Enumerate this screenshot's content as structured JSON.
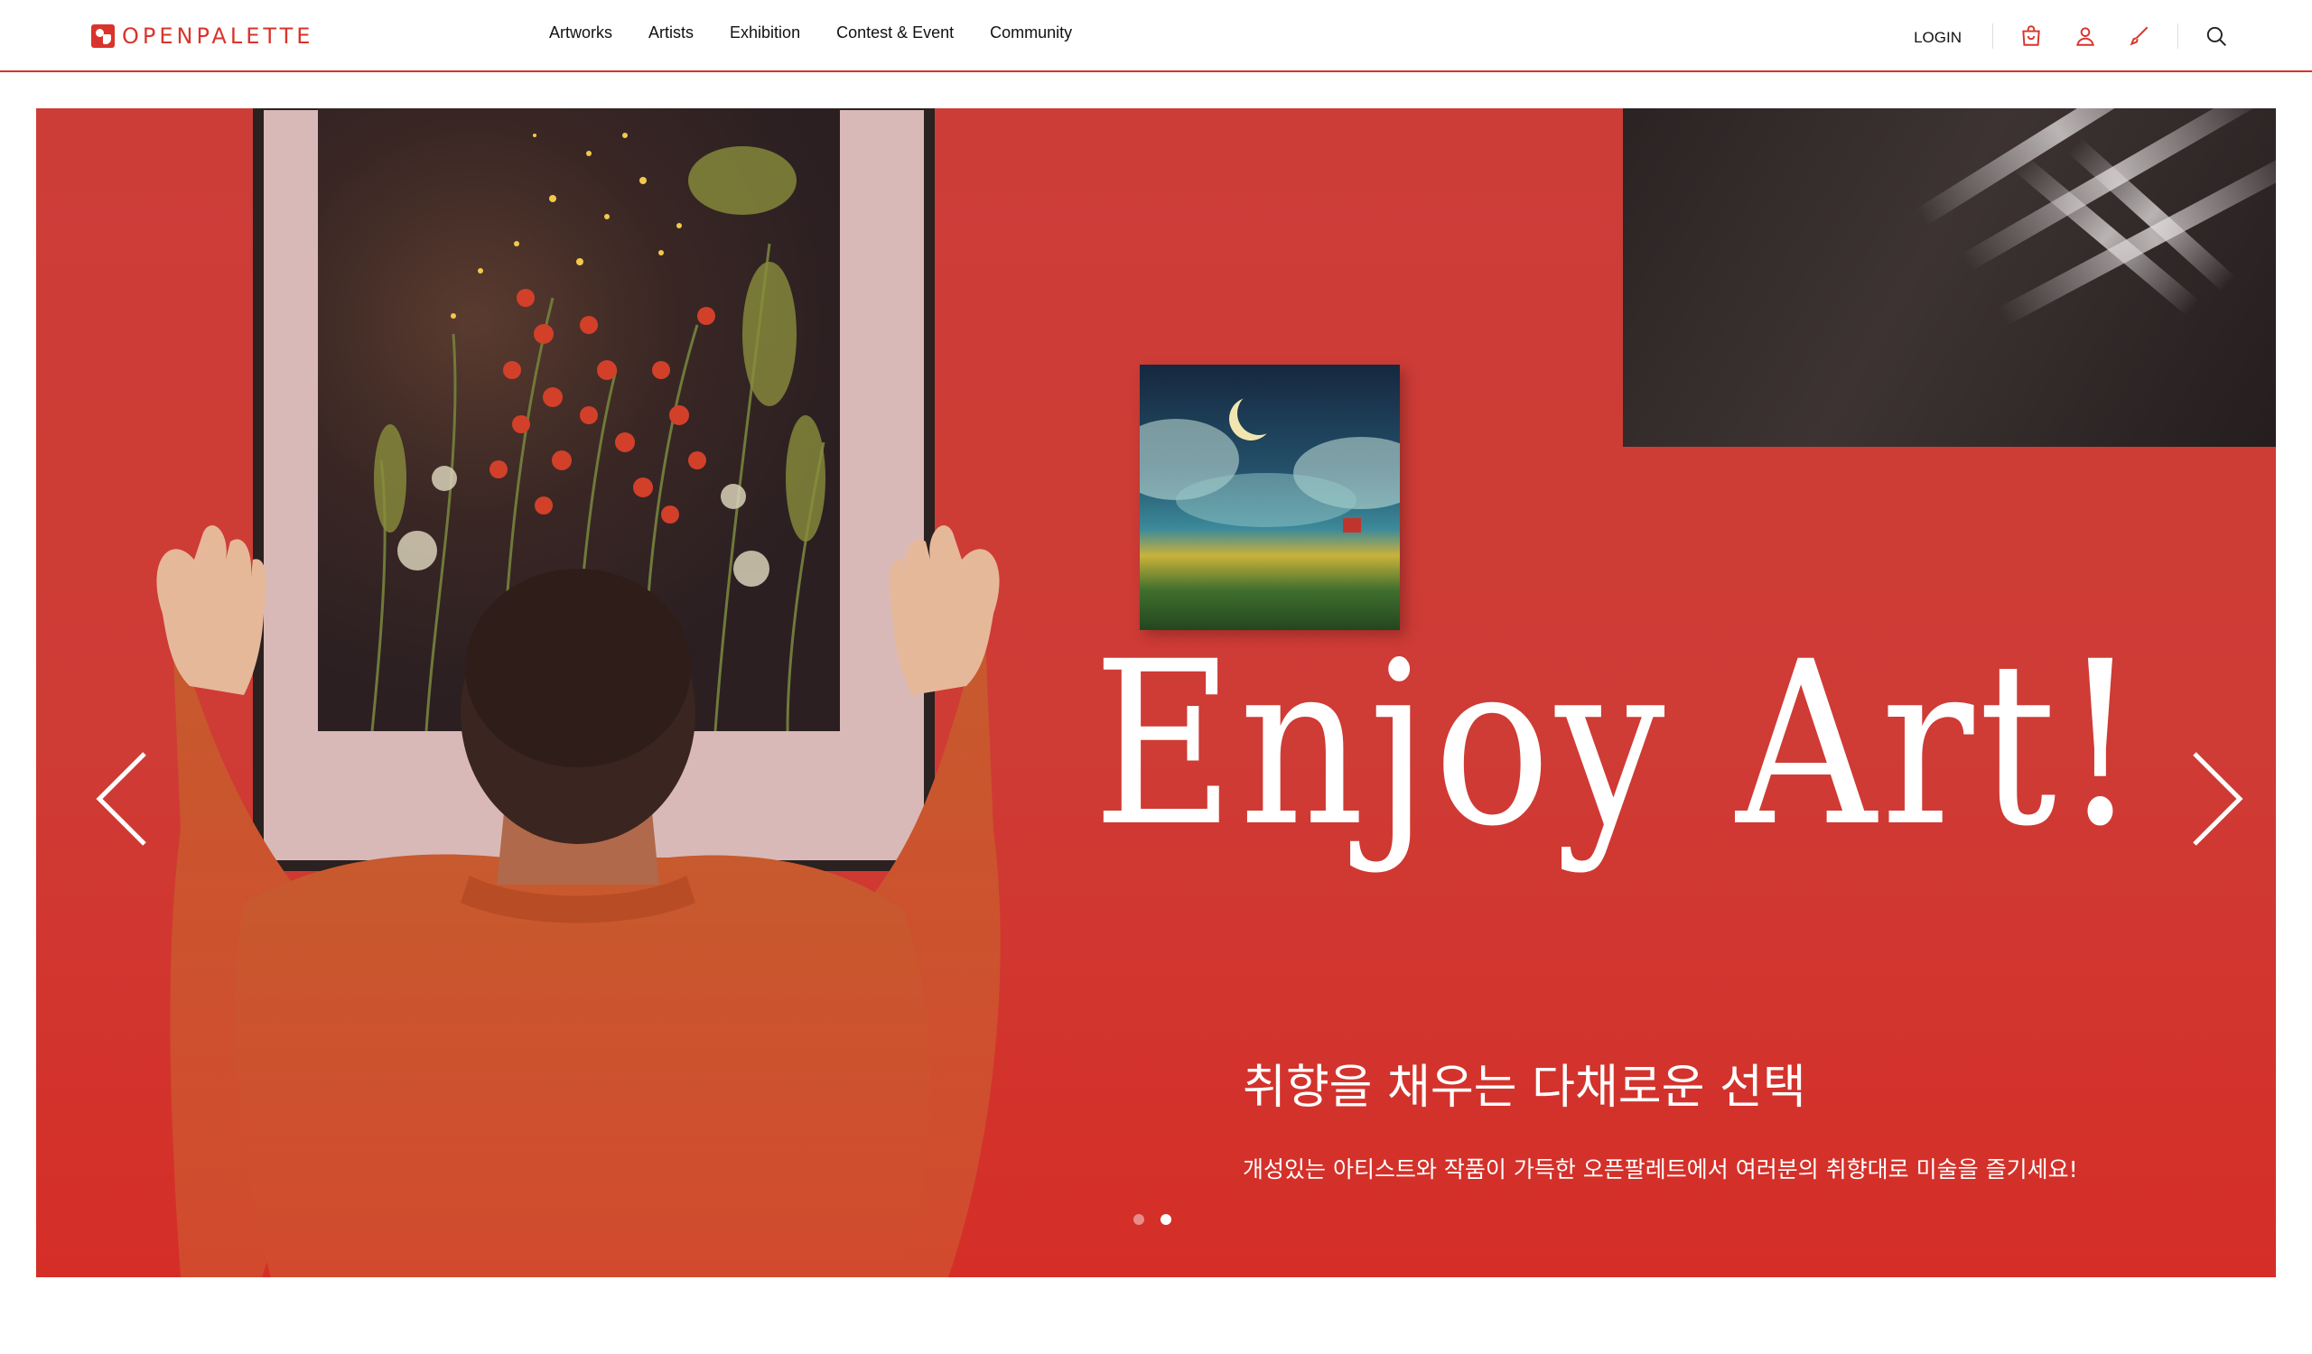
{
  "brand": {
    "name": "OPENPALETTE",
    "accent": "#d9342b"
  },
  "nav": {
    "items": [
      {
        "label": "Artworks"
      },
      {
        "label": "Artists"
      },
      {
        "label": "Exhibition"
      },
      {
        "label": "Contest & Event"
      },
      {
        "label": "Community"
      }
    ]
  },
  "header_right": {
    "login_label": "LOGIN",
    "icons": [
      "shopping-bag-icon",
      "user-icon",
      "brush-icon",
      "search-icon"
    ]
  },
  "hero": {
    "title": "Enjoy Art!",
    "subtitle": "취향을 채우는 다채로운 선택",
    "description": "개성있는 아티스트와 작품이 가득한 오픈팔레트에서 여러분의 취향대로 미술을 즐기세요!",
    "background_color": "#d0392f",
    "slides_total": 2,
    "active_slide": 2
  }
}
